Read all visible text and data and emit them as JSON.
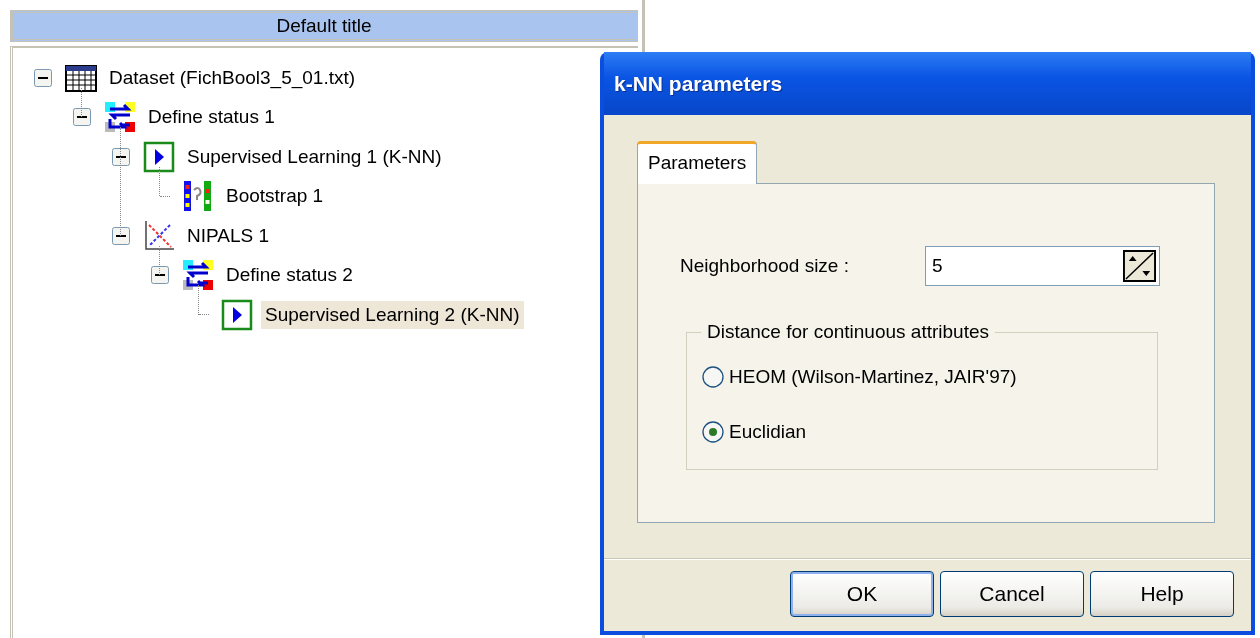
{
  "panel": {
    "title": "Default title"
  },
  "tree": [
    {
      "label": "Dataset (FichBool3_5_01.txt)",
      "kind": "dataset",
      "expanded": true,
      "selected": false,
      "children": [
        {
          "label": "Define status 1",
          "kind": "status",
          "expanded": true,
          "selected": false,
          "children": [
            {
              "label": "Supervised Learning 1 (K-NN)",
              "kind": "learning",
              "expanded": true,
              "selected": false,
              "children": [
                {
                  "label": "Bootstrap 1",
                  "kind": "bootstrap",
                  "selected": false
                }
              ]
            },
            {
              "label": "NIPALS 1",
              "kind": "nipals",
              "expanded": true,
              "selected": false,
              "children": [
                {
                  "label": "Define status 2",
                  "kind": "status",
                  "expanded": true,
                  "selected": false,
                  "children": [
                    {
                      "label": "Supervised Learning 2 (K-NN)",
                      "kind": "learning",
                      "selected": true
                    }
                  ]
                }
              ]
            }
          ]
        }
      ]
    }
  ],
  "dialog": {
    "title": "k-NN parameters",
    "tabs": [
      {
        "label": "Parameters",
        "selected": true
      }
    ],
    "field": {
      "label": "Neighborhood size :",
      "value": "5"
    },
    "group": {
      "title": "Distance for continuous attributes",
      "options": [
        {
          "label": "HEOM (Wilson-Martinez, JAIR'97)",
          "selected": false
        },
        {
          "label": "Euclidian",
          "selected": true
        }
      ]
    },
    "buttons": [
      "OK",
      "Cancel",
      "Help"
    ]
  }
}
